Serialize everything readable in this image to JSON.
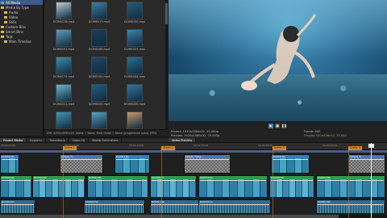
{
  "media_tree": {
    "items": [
      {
        "label": "All Media",
        "selected": true
      },
      {
        "label": "Media By Type",
        "selected": false
      },
      {
        "label": "Audio",
        "selected": false
      },
      {
        "label": "Video",
        "selected": false
      },
      {
        "label": "Stills",
        "selected": false
      },
      {
        "label": "Custom Bins",
        "selected": false
      },
      {
        "label": "Smart Bins",
        "selected": false
      },
      {
        "label": "Tags",
        "selected": false
      },
      {
        "label": "Main Timeline",
        "selected": false
      }
    ]
  },
  "media_grid": {
    "thumbnails": [
      {
        "caption": "DCIM0116.mp4",
        "color": "#b9ccd6"
      },
      {
        "caption": "DCIM0117.mp4",
        "color": "#3f7f9f"
      },
      {
        "caption": "DCIM0150.mov",
        "color": "#2c5d7c"
      },
      {
        "caption": "DCIM0151.mp4",
        "color": "#5aa0c1"
      },
      {
        "caption": "DCIM0168.mp4",
        "color": "#1c3f5a"
      },
      {
        "caption": "DCIM1001.mov",
        "color": "#3b86a8"
      },
      {
        "caption": "DCIM0174.mp4",
        "color": "#3e8cab"
      },
      {
        "caption": "DCIM1200.mp4",
        "color": "#1f4868"
      },
      {
        "caption": "DCIM1044.mov",
        "color": "#2a6e92"
      },
      {
        "caption": "DCIM0311.mp4",
        "color": "#6fb3cf"
      },
      {
        "caption": "DCIM0245.mp4",
        "color": "#245d7e"
      },
      {
        "caption": "DCIM0330.mp4",
        "color": "#31779b"
      },
      {
        "caption": "DCIM1100.mp4",
        "color": "#4494b6"
      },
      {
        "caption": "DCIM1007.mp4",
        "color": "#5a9fc0"
      },
      {
        "caption": "DCIM0882.mp4",
        "color": "#c59a6a"
      },
      {
        "caption": "",
        "color": "#2d6d8e"
      },
      {
        "caption": "",
        "color": "#3d87aa"
      },
      {
        "caption": "",
        "color": "#1f5170"
      }
    ],
    "file_info": "DIR: 4000x3000x24, Alpha = None, Field Order = None (progressive scan), JPEG"
  },
  "preview": {
    "project_line": "Project:  1920x1080x32, 25.000p",
    "preview_line": "Preview:  1920x1080x32, 25.000p",
    "frame_line": "Frame:     642",
    "display_line": "Display:  811x456x32, 25.000",
    "controls": [
      "▶",
      "■",
      "❚❚"
    ]
  },
  "tabs_left": [
    "Project Media",
    "Explorer",
    "Transitions",
    "Video FX",
    "Media Generators"
  ],
  "tabs_right": [
    "Video Preview"
  ],
  "timeline": {
    "ruler_ticks": [
      "00:00:00:00",
      "00:00:10:00",
      "00:00:20:00",
      "00:00:30:00",
      "00:00:40:00",
      "00:00:50:00"
    ],
    "markers": [
      "Scene 1",
      "Scene 2",
      "Scene 3",
      "Scene 4"
    ],
    "track1_clips": [
      "DCIM3140",
      "VEGAS Ti...",
      "DCIM1160",
      "VEGAS Titles...",
      "DCIM3100",
      "VEGAS Ti..."
    ],
    "track2_clips": [
      "DCIM3140",
      "DCIM2230",
      "DCIM1160",
      "DCIM0177",
      "DCIM3110",
      "DCIM0130",
      "DCIM1180"
    ],
    "track3_clips": [
      "DCIM1140",
      "DCIM2230",
      "DCIM1160",
      "DCIM3110",
      "DCIM1180"
    ]
  },
  "colors": {
    "accent": "#3f78c4",
    "marker": "#d98a26",
    "title_clip": "#3b78c8",
    "video_clip": "#2f9b4c",
    "audio_clip": "#2e6e92"
  }
}
